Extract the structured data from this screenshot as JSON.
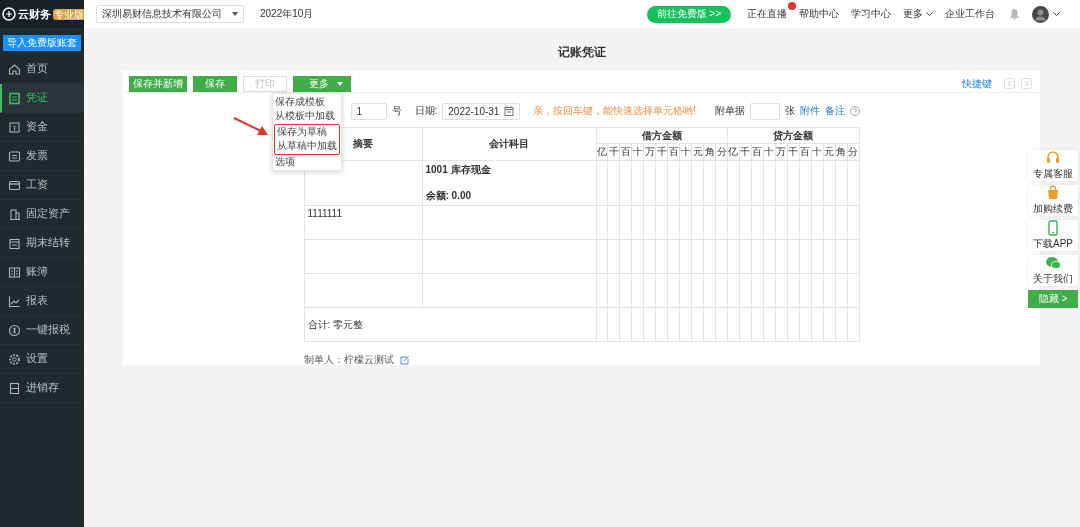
{
  "sidebar": {
    "logo": "云财务",
    "badge": "专业版",
    "import_button": "导入免费版账套",
    "items": [
      {
        "label": "首页",
        "selected": false
      },
      {
        "label": "凭证",
        "selected": true
      },
      {
        "label": "资金",
        "selected": false
      },
      {
        "label": "发票",
        "selected": false
      },
      {
        "label": "工资",
        "selected": false
      },
      {
        "label": "固定资产",
        "selected": false
      },
      {
        "label": "期末结转",
        "selected": false
      },
      {
        "label": "账簿",
        "selected": false
      },
      {
        "label": "报表",
        "selected": false
      },
      {
        "label": "一键报税",
        "selected": false
      },
      {
        "label": "设置",
        "selected": false
      },
      {
        "label": "进销存",
        "selected": false
      }
    ]
  },
  "topbar": {
    "company": "深圳易财信息技术有限公司",
    "period": "2022年10月",
    "upgrade_button": "前往免费版 >>",
    "links": [
      {
        "label": "正在直播",
        "live_badge": true
      },
      {
        "label": "帮助中心",
        "live_badge": false
      },
      {
        "label": "学习中心",
        "live_badge": false
      },
      {
        "label": "更多",
        "live_badge": false,
        "dropdown": true
      },
      {
        "label": "企业工作台",
        "live_badge": false
      }
    ]
  },
  "page_title": "记账凭证",
  "toolbar": {
    "buttons": [
      {
        "label": "保存并新增",
        "disabled": false
      },
      {
        "label": "保存",
        "disabled": false
      },
      {
        "label": "打印",
        "disabled": true
      }
    ],
    "more_button": "更多",
    "more_menu": [
      {
        "label": "保存成模板",
        "marked": false
      },
      {
        "label": "从模板中加载",
        "marked": false
      },
      {
        "label": "保存为草稿",
        "marked": true
      },
      {
        "label": "从草稿中加载",
        "marked": true
      },
      {
        "label": "选项",
        "marked": false
      }
    ],
    "shortcut_link": "快捷键"
  },
  "voucher": {
    "number": "1",
    "number_suffix": "号",
    "date_label": "日期:",
    "date": "2022-10-31",
    "hint": "亲，按回车键，能快速选择单元格哟!",
    "attachments_label": "附单据",
    "attachments_suffix": "张",
    "attachment_link": "附件",
    "note_link": "备注",
    "columns": {
      "summary": "摘要",
      "account": "会计科目",
      "debit": "借方金额",
      "credit": "贷方金额"
    },
    "debit_units": [
      "亿",
      "千",
      "百",
      "十",
      "万",
      "千",
      "百",
      "十",
      "元",
      "角",
      "分"
    ],
    "credit_units": [
      "亿",
      "千",
      "百",
      "十",
      "万",
      "千",
      "百",
      "十",
      "元",
      "角",
      "分"
    ],
    "rows": [
      {
        "account": "1001 库存现金",
        "balance": "余额:  0.00"
      },
      {
        "summary": "1111111"
      },
      {},
      {}
    ],
    "total": "合计: 零元整",
    "maker": "制单人：柠檬云测试"
  },
  "side_panel": {
    "items": [
      "专属客服",
      "加购续费",
      "下载APP",
      "关于我们"
    ],
    "hide_button": "隐藏 >"
  }
}
